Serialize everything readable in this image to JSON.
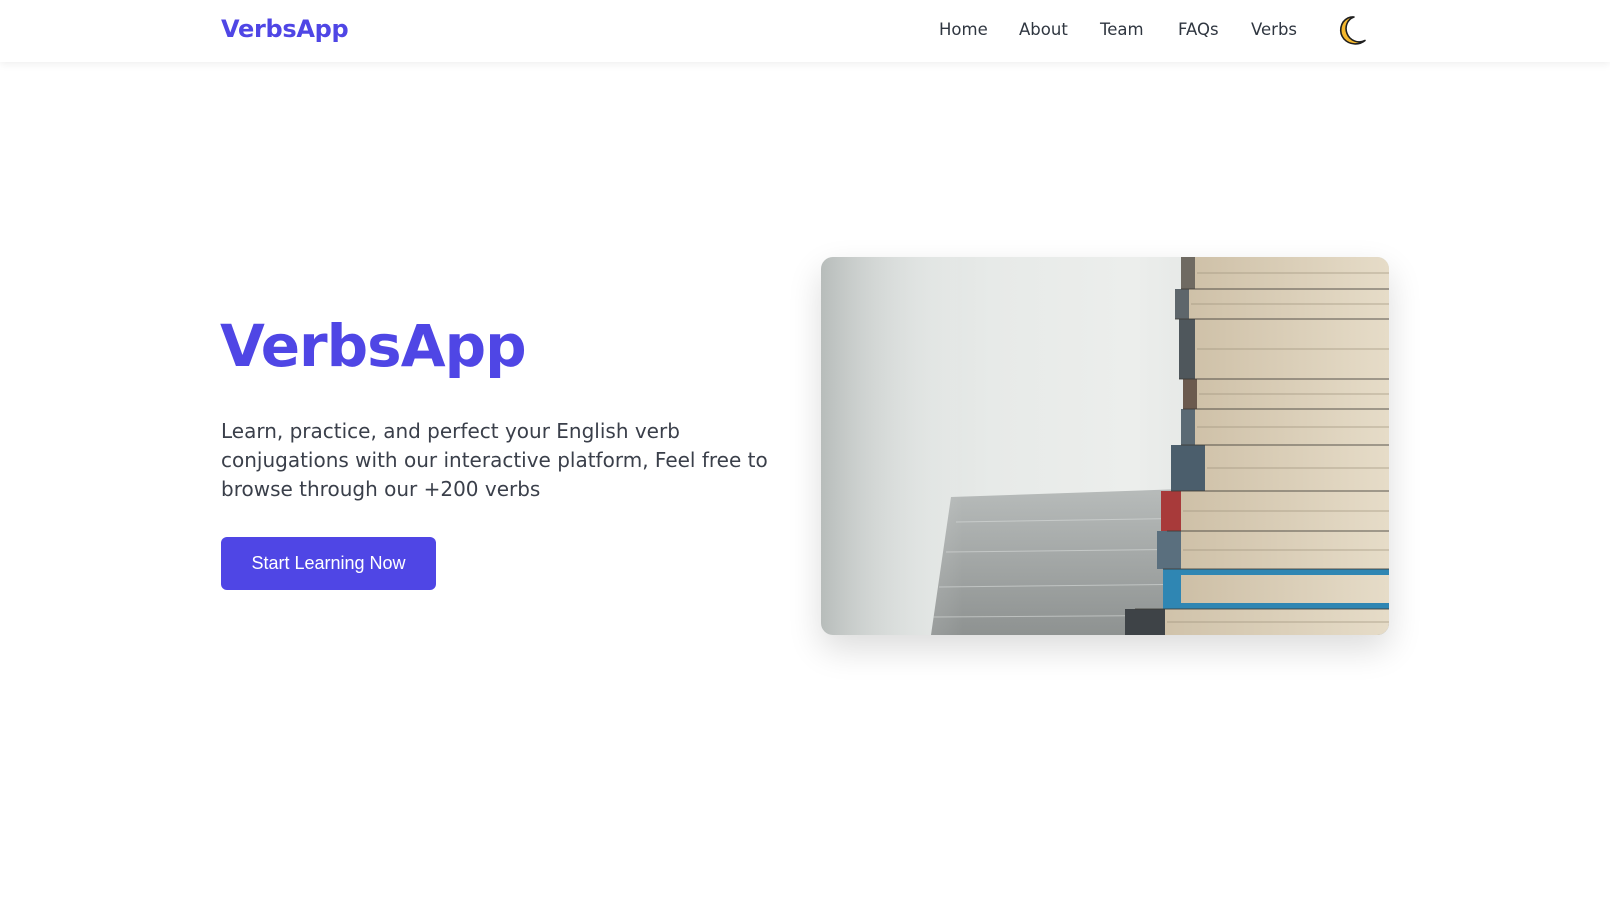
{
  "navbar": {
    "brand": "VerbsApp",
    "links": [
      "Home",
      "About",
      "Team",
      "FAQs",
      "Verbs"
    ],
    "theme_toggle_icon": "moon-icon"
  },
  "hero": {
    "title": "VerbsApp",
    "description": "Learn, practice, and perfect your English verb conjugations with our interactive platform, Feel free to browse through our +200 verbs",
    "cta_label": "Start Learning Now",
    "image_icon": "stack-of-books-photo"
  },
  "colors": {
    "accent": "#4f46e5",
    "text": "#2f3640",
    "background": "#ffffff",
    "moon": "#f5b82e"
  }
}
